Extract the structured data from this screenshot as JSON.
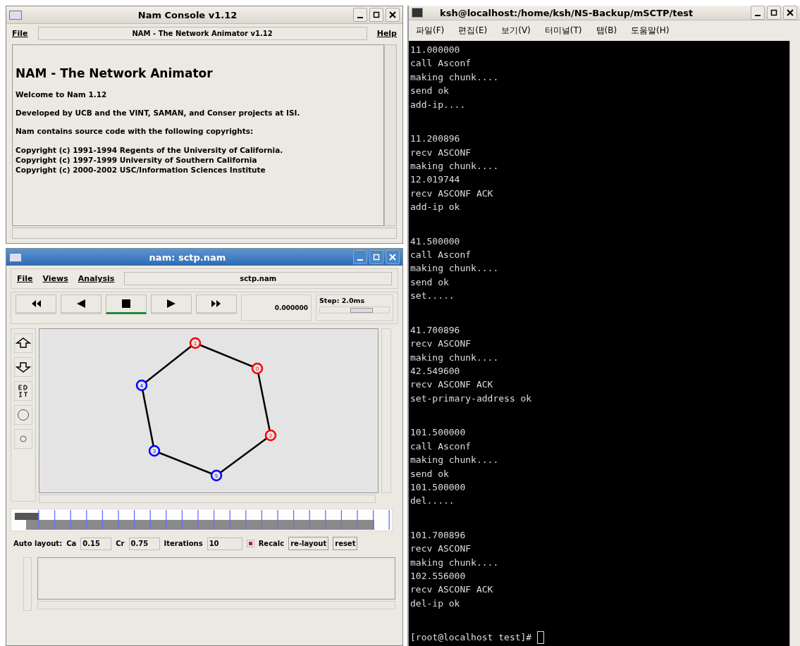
{
  "console": {
    "title": "Nam Console v1.12",
    "menu_left": "File",
    "banner": "NAM - The Network Animator v1.12",
    "menu_right": "Help",
    "heading": "NAM - The Network Animator",
    "paragraphs": [
      "Welcome to Nam 1.12",
      "Developed by UCB and the VINT, SAMAN, and Conser projects at ISI.",
      "Nam contains source code with the following copyrights:"
    ],
    "copyrights": [
      "Copyright (c) 1991-1994 Regents of the University of California.",
      "Copyright (c) 1997-1999 University of Southern California",
      "Copyright (c) 2000-2002 USC/Information Sciences Institute"
    ]
  },
  "nam": {
    "title": "nam: sctp.nam",
    "menu": [
      "File",
      "Views",
      "Analysis"
    ],
    "file_label": "sctp.nam",
    "transport": [
      {
        "kind": "rewind",
        "selected": false
      },
      {
        "kind": "back",
        "selected": false
      },
      {
        "kind": "stop",
        "selected": true
      },
      {
        "kind": "play",
        "selected": false
      },
      {
        "kind": "forward",
        "selected": false
      }
    ],
    "time": "0.000000",
    "step": {
      "label": "Step: 2.0ms",
      "level": 0.6
    },
    "nodes": [
      {
        "label": "1",
        "color": "#ff0000"
      },
      {
        "label": "0",
        "color": "#ff0000"
      },
      {
        "label": "2",
        "color": "#ff0000"
      },
      {
        "label": "5",
        "color": "#0000ff"
      },
      {
        "label": "3",
        "color": "#0000ff"
      },
      {
        "label": "4",
        "color": "#0000ff"
      }
    ],
    "auto_layout": {
      "label": "Auto layout:",
      "ca_label": "Ca",
      "ca": "0.15",
      "cr_label": "Cr",
      "cr": "0.75",
      "iter_label": "Iterations",
      "iterations": "10",
      "recalc": {
        "label": "Recalc",
        "checked": true
      },
      "buttons": [
        "re-layout",
        "reset"
      ]
    }
  },
  "terminal": {
    "title": "ksh@localhost:/home/ksh/NS-Backup/mSCTP/test",
    "menu": [
      "파일(F)",
      "편집(E)",
      "보기(V)",
      "터미널(T)",
      "탭(B)",
      "도움말(H)"
    ],
    "blocks": [
      {
        "lines": [
          "11.000000",
          "call Asconf",
          "making chunk....",
          "send ok",
          "add-ip...."
        ]
      },
      {
        "lines": [
          "11.200896",
          "recv ASCONF",
          "making chunk....",
          "12.019744",
          "recv ASCONF ACK",
          "add-ip ok"
        ]
      },
      {
        "lines": [
          "41.500000",
          "call Asconf",
          "making chunk....",
          "send ok",
          "set....."
        ]
      },
      {
        "lines": [
          "41.700896",
          "recv ASCONF",
          "making chunk....",
          "42.549600",
          "recv ASCONF ACK",
          "set-primary-address ok"
        ]
      },
      {
        "lines": [
          "101.500000",
          "call Asconf",
          "making chunk....",
          "send ok",
          "101.500000",
          "del....."
        ]
      },
      {
        "lines": [
          "101.700896",
          "recv ASCONF",
          "making chunk....",
          "102.556000",
          "recv ASCONF ACK",
          "del-ip ok"
        ]
      }
    ],
    "prompt": "[root@localhost test]#"
  }
}
